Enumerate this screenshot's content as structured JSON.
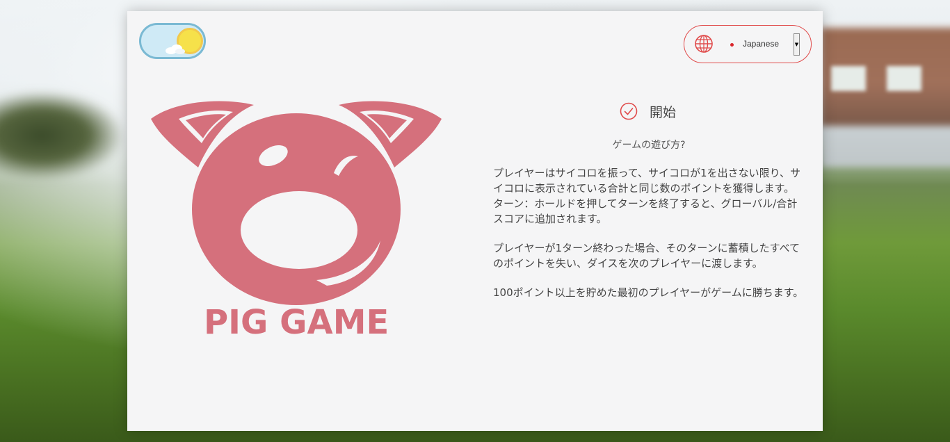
{
  "theme_toggle": {
    "state": "light",
    "icon": "sun-icon"
  },
  "language": {
    "icon": "globe-icon",
    "flag": "japan-flag-icon",
    "selected": "Japanese"
  },
  "logo": {
    "icon": "pig-icon",
    "title": "PIG GAME",
    "color": "#d5707c"
  },
  "start": {
    "icon": "check-circle-icon",
    "label": "開始"
  },
  "instructions": {
    "heading": "ゲームの遊び方?",
    "paragraphs": [
      "プレイヤーはサイコロを振って、サイコロが1を出さない限り、サイコロに表示されている合計と同じ数のポイントを獲得します。　 ターン：ホールドを押してターンを終了すると、グローバル/合計スコアに追加されます。",
      "プレイヤーが1ターン終わった場合、そのターンに蓄積したすべてのポイントを失い、ダイスを次のプレイヤーに渡します。",
      "100ポイント以上を貯めた最初のプレイヤーがゲームに勝ちます。"
    ]
  },
  "colors": {
    "accent": "#e04a4a",
    "card_bg": "#f5f5f6",
    "toggle_bg": "#cfeaf6",
    "sun": "#f6e14a"
  }
}
